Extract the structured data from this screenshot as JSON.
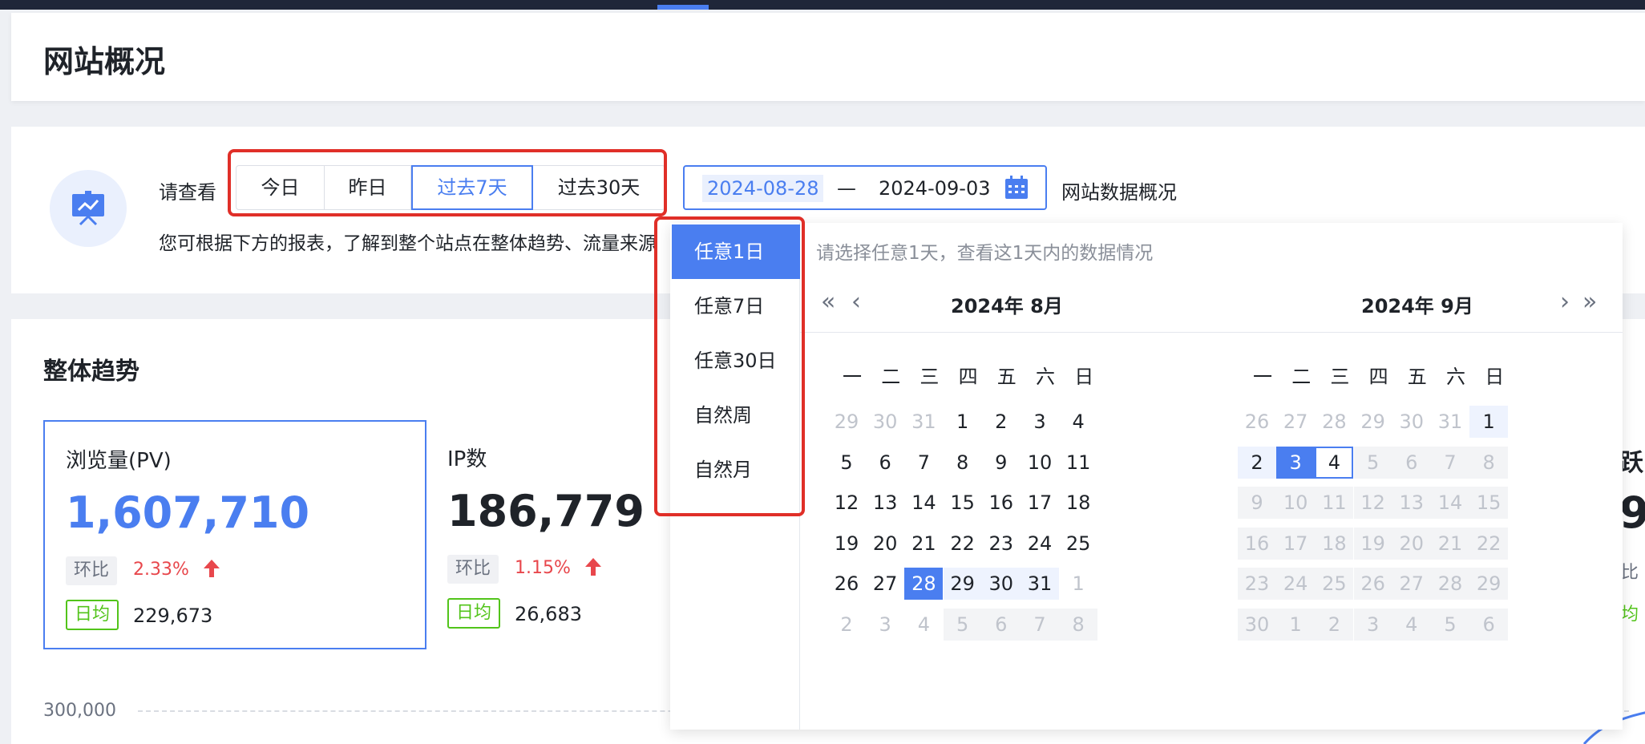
{
  "page": {
    "title": "网站概况"
  },
  "filter": {
    "please_view": "请查看",
    "ranges": [
      {
        "label": "今日",
        "active": false
      },
      {
        "label": "昨日",
        "active": false
      },
      {
        "label": "过去7天",
        "active": true
      },
      {
        "label": "过去30天",
        "active": false
      }
    ],
    "date_start": "2024-08-28",
    "date_sep": "—",
    "date_end": "2024-09-03",
    "overview_label": "网站数据概况",
    "description": "您可根据下方的报表，了解到整个站点在整体趋势、流量来源"
  },
  "trend": {
    "title": "整体趋势",
    "metrics": [
      {
        "label": "浏览量(PV)",
        "value": "1,607,710",
        "hb_label": "环比",
        "change": "2.33%",
        "avg_label": "日均",
        "avg": "229,673"
      },
      {
        "label": "IP数",
        "value": "186,779",
        "hb_label": "环比",
        "change": "1.15%",
        "avg_label": "日均",
        "avg": "26,683"
      }
    ],
    "partial_metric_label": "跃",
    "partial_metric_value": "9",
    "partial_hb": "比",
    "partial_avg": "均",
    "y_tick": "300,000"
  },
  "popup": {
    "shortcuts": [
      "任意1日",
      "任意7日",
      "任意30日",
      "自然周",
      "自然月"
    ],
    "active_shortcut": 0,
    "hint": "请选择任意1天，查看这1天内的数据情况",
    "weekdays": [
      "一",
      "二",
      "三",
      "四",
      "五",
      "六",
      "日"
    ],
    "left_month_title": "2024年  8月",
    "right_month_title": "2024年  9月",
    "left_days": [
      [
        "29",
        "30",
        "31",
        "1",
        "2",
        "3",
        "4"
      ],
      [
        "5",
        "6",
        "7",
        "8",
        "9",
        "10",
        "11"
      ],
      [
        "12",
        "13",
        "14",
        "15",
        "16",
        "17",
        "18"
      ],
      [
        "19",
        "20",
        "21",
        "22",
        "23",
        "24",
        "25"
      ],
      [
        "26",
        "27",
        "28",
        "29",
        "30",
        "31",
        "1"
      ],
      [
        "2",
        "3",
        "4",
        "5",
        "6",
        "7",
        "8"
      ]
    ],
    "right_days": [
      [
        "26",
        "27",
        "28",
        "29",
        "30",
        "31",
        "1"
      ],
      [
        "2",
        "3",
        "4",
        "5",
        "6",
        "7",
        "8"
      ],
      [
        "9",
        "10",
        "11",
        "12",
        "13",
        "14",
        "15"
      ],
      [
        "16",
        "17",
        "18",
        "19",
        "20",
        "21",
        "22"
      ],
      [
        "23",
        "24",
        "25",
        "26",
        "27",
        "28",
        "29"
      ],
      [
        "30",
        "1",
        "2",
        "3",
        "4",
        "5",
        "6"
      ]
    ],
    "nav": {
      "prev_year": "«",
      "prev_month": "‹",
      "next_month": "›",
      "next_year": "»"
    }
  },
  "colors": {
    "accent": "#4a7ef0",
    "red_highlight": "#e02f28",
    "up": "#e8474c",
    "green": "#52c41a"
  }
}
